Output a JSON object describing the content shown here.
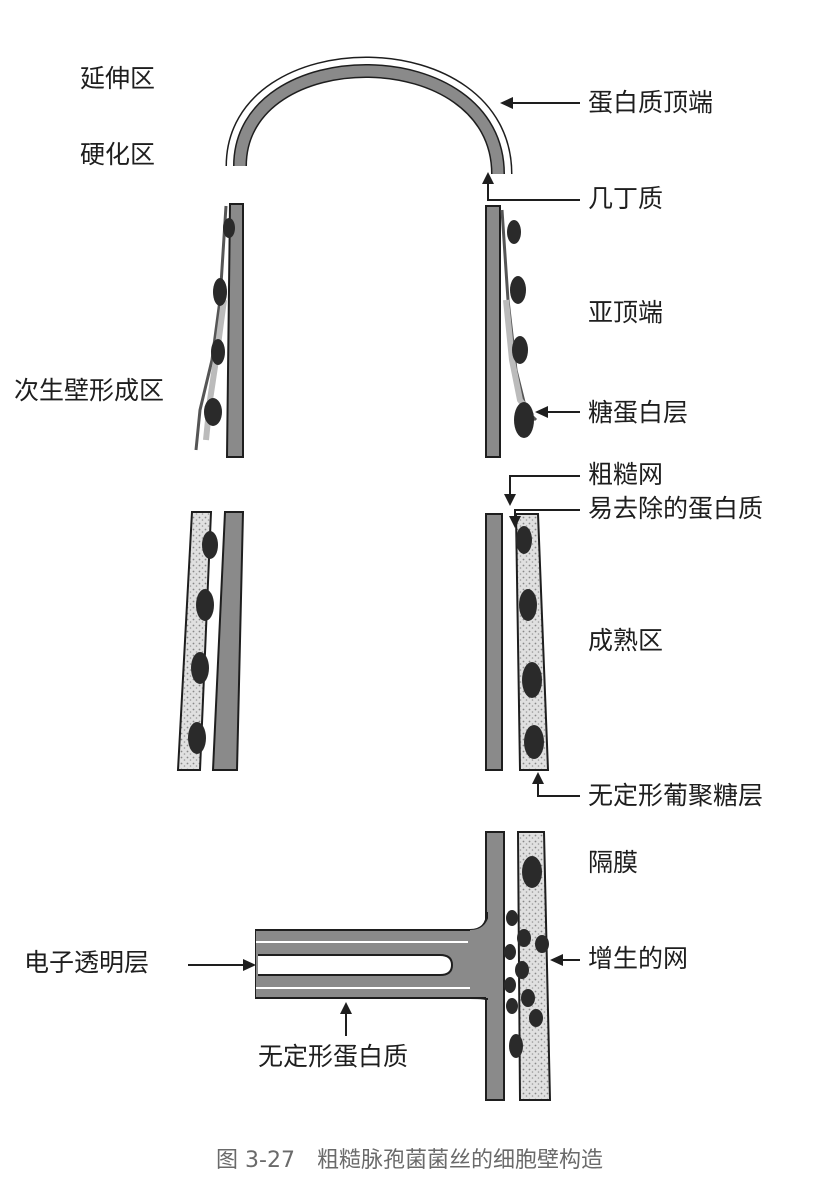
{
  "labels": {
    "elongation_zone": "延伸区",
    "hardening_zone": "硬化区",
    "secondary_wall_zone": "次生壁形成区",
    "protein_tip": "蛋白质顶端",
    "chitin": "几丁质",
    "subapical": "亚顶端",
    "glycoprotein_layer": "糖蛋白层",
    "rough_network": "粗糙网",
    "removable_protein": "易去除的蛋白质",
    "mature_zone": "成熟区",
    "amorphous_glucan_layer": "无定形葡聚糖层",
    "septum": "隔膜",
    "electron_transparent_layer": "电子透明层",
    "proliferated_network": "增生的网",
    "amorphous_protein": "无定形蛋白质"
  },
  "caption": "图 3-27　粗糙脉孢菌菌丝的细胞壁构造",
  "colors": {
    "wall_gray": "#8a8a8a",
    "stroke": "#1e1e1e",
    "stipple": "#d2d2d2",
    "granule": "#2a2a2a"
  }
}
